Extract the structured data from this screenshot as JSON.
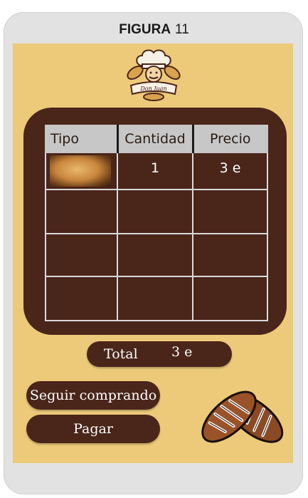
{
  "header": {
    "title": "FIGURA",
    "number": "11"
  },
  "logo": {
    "brand": "Don Juan",
    "icon": "chef-baker-logo-icon"
  },
  "order_table": {
    "columns": [
      "Tipo",
      "Cantidad",
      "Precio"
    ],
    "rows": [
      {
        "tipo_image": "bread-roll-image",
        "cantidad": "1",
        "precio": "3 e"
      },
      {
        "tipo_image": "",
        "cantidad": "",
        "precio": ""
      },
      {
        "tipo_image": "",
        "cantidad": "",
        "precio": ""
      },
      {
        "tipo_image": "",
        "cantidad": "",
        "precio": ""
      }
    ]
  },
  "total": {
    "label": "Total",
    "value": "3 e"
  },
  "buttons": {
    "continue_label": "Seguir comprando",
    "pay_label": "Pagar"
  },
  "decoration": {
    "icon": "bread-loaves-icon"
  },
  "colors": {
    "background": "#ecca7a",
    "brown": "#4a2519",
    "header_gray": "#c7c7c7",
    "frame": "#e2e2e2"
  }
}
